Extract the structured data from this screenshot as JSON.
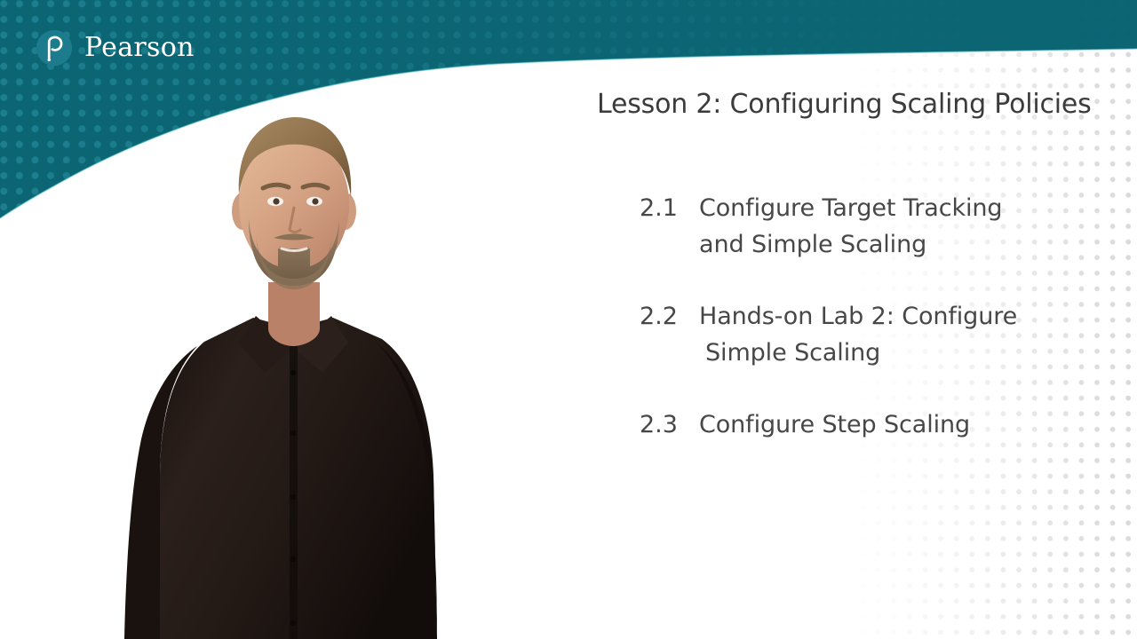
{
  "brand": {
    "name": "Pearson",
    "logo_icon": "pearson-p-circle-icon",
    "logo_color": "#1C7B8C",
    "band_color": "#0B6573",
    "band_dot_color": "#1D7F8E"
  },
  "slide": {
    "title": "Lesson 2: Configuring Scaling Policies",
    "title_color": "#3B3B3B",
    "background_color": "#FFFFFF",
    "dot_pattern_color": "#D9D9D9",
    "topics": [
      {
        "number": "2.1",
        "line1": "Configure Target Tracking",
        "line2": "and Simple Scaling"
      },
      {
        "number": "2.2",
        "line1": "Hands-on Lab 2: Configure",
        "line2": "Simple Scaling"
      },
      {
        "number": "2.3",
        "line1": "Configure Step Scaling",
        "line2": ""
      }
    ]
  },
  "presenter": {
    "description": "male instructor in dark button-up shirt",
    "shirt_color": "#241B18",
    "hair_color": "#9A7B57",
    "skin_color": "#D8A98C"
  }
}
